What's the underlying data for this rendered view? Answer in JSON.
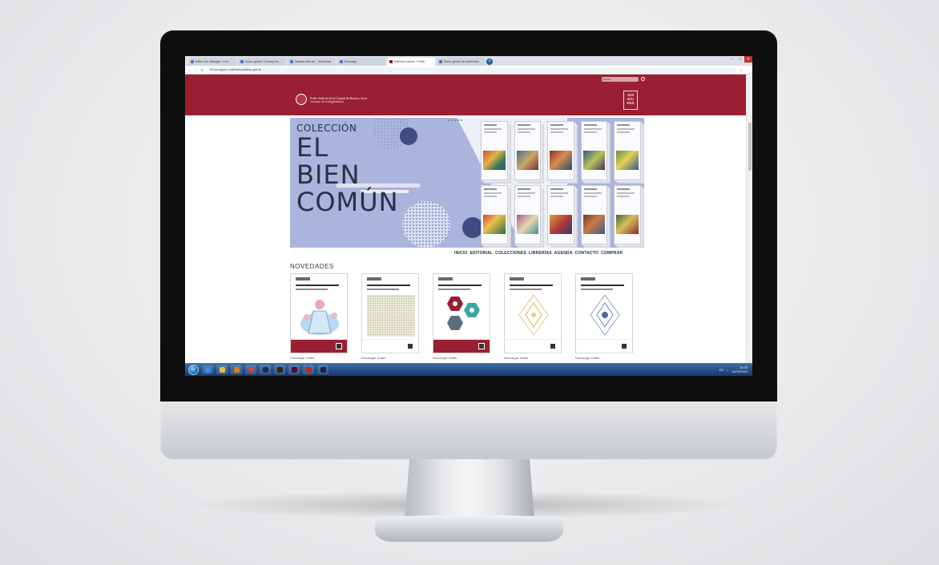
{
  "browser": {
    "tabs": [
      {
        "label": "Editor Jud. Manager / Con..."
      },
      {
        "label": "Nuevo gestor / Consejo de..."
      },
      {
        "label": "Nuestra obra de ... Ediciones"
      },
      {
        "label": "Descarga"
      },
      {
        "label": "Editorial Judicial - Portal"
      },
      {
        "label": "Nuevo gestor de contenidos"
      }
    ],
    "active_tab_index": 4,
    "address": "No es seguro | editorial.jusbaires.gob.ar",
    "controls": {
      "min": "–",
      "max": "□",
      "close": "✕"
    }
  },
  "site": {
    "brand_line1": "Poder Judicial de la Ciudad de Buenos Aires",
    "brand_line2": "Consejo de la Magistratura",
    "logo_mark": "JUS BAI RES",
    "search_placeholder": "Buscar",
    "social": [
      "f",
      "i",
      "◎",
      "t"
    ],
    "banner": {
      "line1": "COLECCIÓN",
      "line2": "EL",
      "line3": "BIEN",
      "line4": "COMÚN"
    },
    "nav": [
      "INICIO",
      "EDITORIAL",
      "COLECCIONES",
      "LIBRERÍAS",
      "AGENDA",
      "CONTACTO",
      "COMPRAR"
    ],
    "novedades_title": "NOVEDADES",
    "products": [
      {
        "name": "Descargar Gratis",
        "footer": "red",
        "art": "figure"
      },
      {
        "name": "Descargar Gratis",
        "footer": "white",
        "art": "pattern"
      },
      {
        "name": "Descargar Gratis",
        "footer": "red",
        "art": "hexagons"
      },
      {
        "name": "Descargar Gratis",
        "footer": "white",
        "art": "diamond"
      },
      {
        "name": "Descargar Gratis",
        "footer": "white",
        "art": "diamond-blue"
      }
    ]
  },
  "taskbar": {
    "time": "10:30",
    "date": "12/03/2020",
    "tray_text": "ES"
  },
  "colors": {
    "header_red": "#9a1f32",
    "banner_blue": "#aab4dc",
    "banner_dark": "#3f4c82"
  }
}
